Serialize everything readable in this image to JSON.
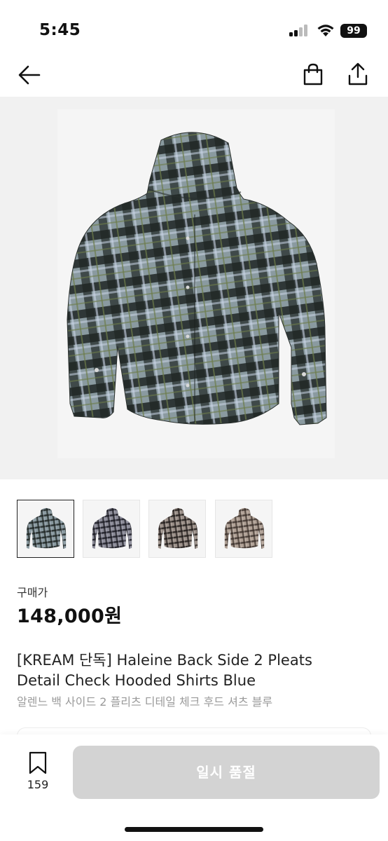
{
  "status_bar": {
    "time": "5:45",
    "battery": "99"
  },
  "product": {
    "price_label": "구매가",
    "price": "148,000원",
    "title_line1": "[KREAM 단독] Haleine Back Side 2 Pleats",
    "title_line2": "Detail Check Hooded Shirts Blue",
    "subtitle": "알렌느 백 사이드 2 플리츠 디테일 체크 후드 셔츠 블루",
    "thumbnail_colors": [
      "#5a6a68",
      "#4a4a55",
      "#5b524e",
      "#6d5f58"
    ]
  },
  "bottom_bar": {
    "bookmark_count": "159",
    "button_label": "일시 품절"
  },
  "icons": [
    "back-arrow-icon",
    "shopping-bag-icon",
    "share-icon",
    "bookmark-icon"
  ]
}
